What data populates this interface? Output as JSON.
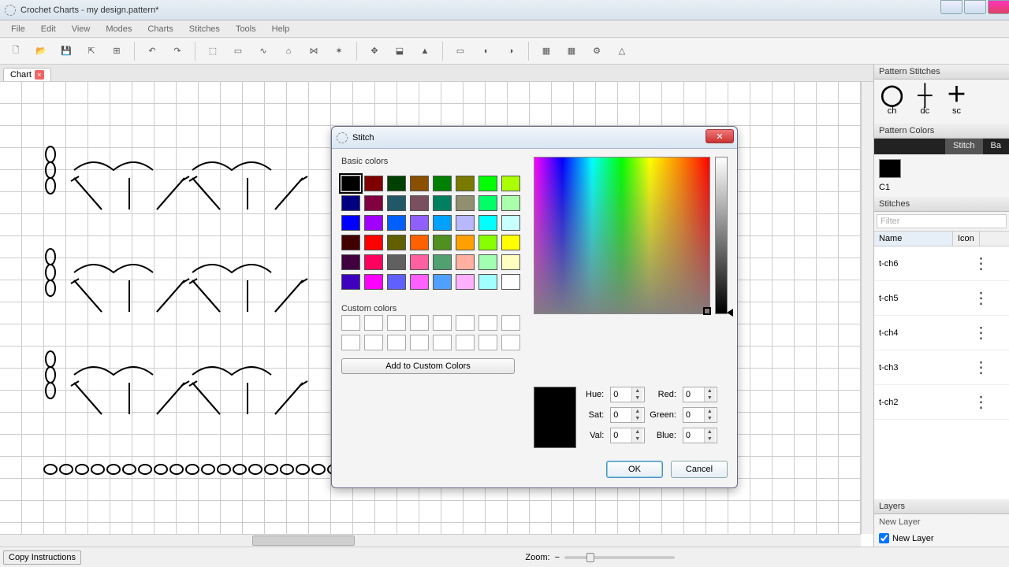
{
  "app": {
    "title": "Crochet Charts - my design.pattern*"
  },
  "menus": [
    "File",
    "Edit",
    "View",
    "Modes",
    "Charts",
    "Stitches",
    "Tools",
    "Help"
  ],
  "tab": {
    "label": "Chart"
  },
  "sidebar": {
    "pattern_stitches_hdr": "Pattern Stitches",
    "stitches": [
      {
        "sym": "◯",
        "label": "ch"
      },
      {
        "sym": "┼",
        "label": "dc"
      },
      {
        "sym": "＋",
        "label": "sc"
      }
    ],
    "pattern_colors_hdr": "Pattern Colors",
    "color_tabs": {
      "stitch": "Stitch",
      "back": "Ba"
    },
    "color_label": "C1",
    "stitches_hdr": "Stitches",
    "filter_placeholder": "Filter",
    "col_name": "Name",
    "col_icon": "Icon",
    "stitch_rows": [
      {
        "name": "t-ch6",
        "icon": "⋮"
      },
      {
        "name": "t-ch5",
        "icon": "⋮"
      },
      {
        "name": "t-ch4",
        "icon": "⋮"
      },
      {
        "name": "t-ch3",
        "icon": "⋮"
      },
      {
        "name": "t-ch2",
        "icon": "⋮"
      }
    ],
    "layers_hdr": "Layers",
    "layer_new": "New Layer",
    "layer_item": "New Layer"
  },
  "statusbar": {
    "copy": "Copy Instructions",
    "zoom_label": "Zoom:"
  },
  "dialog": {
    "title": "Stitch",
    "basic_label": "Basic colors",
    "custom_label": "Custom colors",
    "add_custom": "Add to Custom Colors",
    "hue": "Hue:",
    "sat": "Sat:",
    "val": "Val:",
    "red": "Red:",
    "green": "Green:",
    "blue": "Blue:",
    "v_hue": "0",
    "v_sat": "0",
    "v_val": "0",
    "v_red": "0",
    "v_green": "0",
    "v_blue": "0",
    "ok": "OK",
    "cancel": "Cancel",
    "basic_colors": [
      "#000000",
      "#800000",
      "#004000",
      "#8a5000",
      "#008000",
      "#7a7a00",
      "#00ff00",
      "#aaff00",
      "#000080",
      "#800040",
      "#205868",
      "#7a5060",
      "#008060",
      "#909070",
      "#00ff66",
      "#aaffaa",
      "#0000ff",
      "#a000ff",
      "#0060ff",
      "#9060ff",
      "#00a0ff",
      "#b8b8ff",
      "#00ffff",
      "#c8ffff",
      "#400000",
      "#ff0000",
      "#606000",
      "#ff6000",
      "#509020",
      "#ffa000",
      "#88ff00",
      "#ffff00",
      "#400040",
      "#ff0060",
      "#606060",
      "#ff60a0",
      "#50a070",
      "#ffb0a0",
      "#a0ffb0",
      "#ffffc0",
      "#4000c0",
      "#ff00ff",
      "#6060ff",
      "#ff60ff",
      "#50a0ff",
      "#ffb0ff",
      "#a0ffff",
      "#ffffff"
    ]
  }
}
